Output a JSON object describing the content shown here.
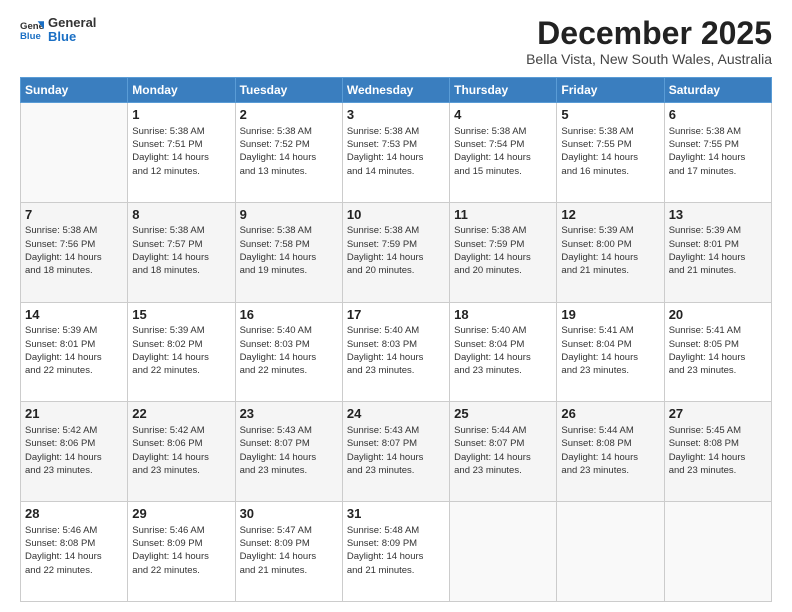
{
  "logo": {
    "line1": "General",
    "line2": "Blue"
  },
  "header": {
    "month": "December 2025",
    "location": "Bella Vista, New South Wales, Australia"
  },
  "weekdays": [
    "Sunday",
    "Monday",
    "Tuesday",
    "Wednesday",
    "Thursday",
    "Friday",
    "Saturday"
  ],
  "weeks": [
    [
      {
        "day": "",
        "info": ""
      },
      {
        "day": "1",
        "info": "Sunrise: 5:38 AM\nSunset: 7:51 PM\nDaylight: 14 hours\nand 12 minutes."
      },
      {
        "day": "2",
        "info": "Sunrise: 5:38 AM\nSunset: 7:52 PM\nDaylight: 14 hours\nand 13 minutes."
      },
      {
        "day": "3",
        "info": "Sunrise: 5:38 AM\nSunset: 7:53 PM\nDaylight: 14 hours\nand 14 minutes."
      },
      {
        "day": "4",
        "info": "Sunrise: 5:38 AM\nSunset: 7:54 PM\nDaylight: 14 hours\nand 15 minutes."
      },
      {
        "day": "5",
        "info": "Sunrise: 5:38 AM\nSunset: 7:55 PM\nDaylight: 14 hours\nand 16 minutes."
      },
      {
        "day": "6",
        "info": "Sunrise: 5:38 AM\nSunset: 7:55 PM\nDaylight: 14 hours\nand 17 minutes."
      }
    ],
    [
      {
        "day": "7",
        "info": "Sunrise: 5:38 AM\nSunset: 7:56 PM\nDaylight: 14 hours\nand 18 minutes."
      },
      {
        "day": "8",
        "info": "Sunrise: 5:38 AM\nSunset: 7:57 PM\nDaylight: 14 hours\nand 18 minutes."
      },
      {
        "day": "9",
        "info": "Sunrise: 5:38 AM\nSunset: 7:58 PM\nDaylight: 14 hours\nand 19 minutes."
      },
      {
        "day": "10",
        "info": "Sunrise: 5:38 AM\nSunset: 7:59 PM\nDaylight: 14 hours\nand 20 minutes."
      },
      {
        "day": "11",
        "info": "Sunrise: 5:38 AM\nSunset: 7:59 PM\nDaylight: 14 hours\nand 20 minutes."
      },
      {
        "day": "12",
        "info": "Sunrise: 5:39 AM\nSunset: 8:00 PM\nDaylight: 14 hours\nand 21 minutes."
      },
      {
        "day": "13",
        "info": "Sunrise: 5:39 AM\nSunset: 8:01 PM\nDaylight: 14 hours\nand 21 minutes."
      }
    ],
    [
      {
        "day": "14",
        "info": "Sunrise: 5:39 AM\nSunset: 8:01 PM\nDaylight: 14 hours\nand 22 minutes."
      },
      {
        "day": "15",
        "info": "Sunrise: 5:39 AM\nSunset: 8:02 PM\nDaylight: 14 hours\nand 22 minutes."
      },
      {
        "day": "16",
        "info": "Sunrise: 5:40 AM\nSunset: 8:03 PM\nDaylight: 14 hours\nand 22 minutes."
      },
      {
        "day": "17",
        "info": "Sunrise: 5:40 AM\nSunset: 8:03 PM\nDaylight: 14 hours\nand 23 minutes."
      },
      {
        "day": "18",
        "info": "Sunrise: 5:40 AM\nSunset: 8:04 PM\nDaylight: 14 hours\nand 23 minutes."
      },
      {
        "day": "19",
        "info": "Sunrise: 5:41 AM\nSunset: 8:04 PM\nDaylight: 14 hours\nand 23 minutes."
      },
      {
        "day": "20",
        "info": "Sunrise: 5:41 AM\nSunset: 8:05 PM\nDaylight: 14 hours\nand 23 minutes."
      }
    ],
    [
      {
        "day": "21",
        "info": "Sunrise: 5:42 AM\nSunset: 8:06 PM\nDaylight: 14 hours\nand 23 minutes."
      },
      {
        "day": "22",
        "info": "Sunrise: 5:42 AM\nSunset: 8:06 PM\nDaylight: 14 hours\nand 23 minutes."
      },
      {
        "day": "23",
        "info": "Sunrise: 5:43 AM\nSunset: 8:07 PM\nDaylight: 14 hours\nand 23 minutes."
      },
      {
        "day": "24",
        "info": "Sunrise: 5:43 AM\nSunset: 8:07 PM\nDaylight: 14 hours\nand 23 minutes."
      },
      {
        "day": "25",
        "info": "Sunrise: 5:44 AM\nSunset: 8:07 PM\nDaylight: 14 hours\nand 23 minutes."
      },
      {
        "day": "26",
        "info": "Sunrise: 5:44 AM\nSunset: 8:08 PM\nDaylight: 14 hours\nand 23 minutes."
      },
      {
        "day": "27",
        "info": "Sunrise: 5:45 AM\nSunset: 8:08 PM\nDaylight: 14 hours\nand 23 minutes."
      }
    ],
    [
      {
        "day": "28",
        "info": "Sunrise: 5:46 AM\nSunset: 8:08 PM\nDaylight: 14 hours\nand 22 minutes."
      },
      {
        "day": "29",
        "info": "Sunrise: 5:46 AM\nSunset: 8:09 PM\nDaylight: 14 hours\nand 22 minutes."
      },
      {
        "day": "30",
        "info": "Sunrise: 5:47 AM\nSunset: 8:09 PM\nDaylight: 14 hours\nand 21 minutes."
      },
      {
        "day": "31",
        "info": "Sunrise: 5:48 AM\nSunset: 8:09 PM\nDaylight: 14 hours\nand 21 minutes."
      },
      {
        "day": "",
        "info": ""
      },
      {
        "day": "",
        "info": ""
      },
      {
        "day": "",
        "info": ""
      }
    ]
  ]
}
